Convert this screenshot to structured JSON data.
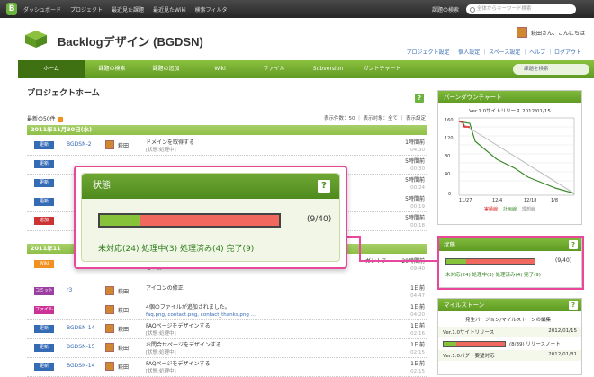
{
  "topbar": {
    "logo": "B",
    "nav": [
      "ダッシュボード",
      "プロジェクト",
      "最近見た課題",
      "最近見たWiki",
      "検索フィルタ"
    ],
    "settings": "課題の検索",
    "search_placeholder": "全体からキーワード検索"
  },
  "header": {
    "project_title": "Backlogデザイン (BGDSN)",
    "user_greeting": "萩田さん、こんにちは",
    "sublinks": "プロジェクト設定 ｜ 個人設定 ｜ スペース設定 ｜ ヘルプ ｜ ログアウト"
  },
  "navbar": {
    "items": [
      "ホーム",
      "課題の検索",
      "課題の追加",
      "Wiki",
      "ファイル",
      "Subversion",
      "ガントチャート"
    ],
    "search_placeholder": "課題を検索"
  },
  "main": {
    "title": "プロジェクトホーム",
    "latest_label": "最新の50件",
    "display_info": "表示件数：50 ｜ 表示対象：全て ｜ 表示設定",
    "day1": "2011年11月30日(水)",
    "day2": "2011年11",
    "rows": [
      {
        "badge": "更新",
        "color": "#356ab5",
        "key": "BGDSN-2",
        "user": "萩田",
        "text": "ドメインを取得する",
        "sub": "[状態:処理中]",
        "time": "1時間前",
        "time2": "04:30"
      },
      {
        "badge": "更新",
        "color": "#356ab5",
        "key": "",
        "user": "",
        "text": "",
        "sub": "",
        "time": "5時間前",
        "time2": "00:30"
      },
      {
        "badge": "更新",
        "color": "#356ab5",
        "key": "",
        "user": "",
        "text": "",
        "sub": "",
        "time": "5時間前",
        "time2": "00:24"
      },
      {
        "badge": "更新",
        "color": "#356ab5",
        "key": "",
        "user": "",
        "text": "",
        "sub": "",
        "time": "5時間前",
        "time2": "00:19"
      },
      {
        "badge": "追加",
        "color": "#cc3333",
        "key": "",
        "user": "",
        "text": "",
        "sub": "",
        "time": "5時間前",
        "time2": "00:18"
      }
    ],
    "rows2": [
      {
        "badge": "Wiki",
        "color": "#f29020",
        "key": "",
        "user": "",
        "text": "ーガントチ",
        "sub": "セー...",
        "time": "20時間前",
        "time2": "09:40"
      },
      {
        "badge": "コミット",
        "color": "#9b3fa0",
        "key": "r3",
        "user": "萩田",
        "text": "アイコンの修正",
        "sub": "",
        "time": "1日前",
        "time2": "04:47"
      },
      {
        "badge": "ファイル",
        "color": "#cc3399",
        "key": "",
        "user": "萩田",
        "text": "4個のファイルが追加されました。",
        "sub": "faq.png,  contact.png,  contact_thanks.png ...",
        "time": "1日前",
        "time2": "04:20"
      },
      {
        "badge": "更新",
        "color": "#356ab5",
        "key": "BGDSN-14",
        "user": "萩田",
        "text": "FAQページをデザインする",
        "sub": "[状態:処理中]",
        "time": "1日前",
        "time2": "02:16"
      },
      {
        "badge": "更新",
        "color": "#356ab5",
        "key": "BGDSN-15",
        "user": "萩田",
        "text": "お問合せページをデザインする",
        "sub": "[状態:処理中]",
        "time": "1日前",
        "time2": "02:15"
      },
      {
        "badge": "更新",
        "color": "#356ab5",
        "key": "BGDSN-14",
        "user": "萩田",
        "text": "FAQページをデザインする",
        "sub": "[状態:処理中]",
        "time": "1日前",
        "time2": "02:15"
      }
    ]
  },
  "burndown": {
    "title": "バーンダウンチャート",
    "caption": "Ver.1.0サイトリリース 2012/01/15",
    "legend": [
      "実績線",
      "計画線",
      "理想線"
    ]
  },
  "status_small": {
    "title": "状態",
    "count": "(9/40)",
    "legend": "未対応(24) 処理中(3) 処理済み(4) 完了(9)"
  },
  "milestone": {
    "title": "マイルストーン",
    "edit": "発生バージョン/マイルストーンの編集",
    "items": [
      {
        "name": "Ver.1.0サイトリリース",
        "date": "2012/01/15"
      },
      {
        "name": "",
        "date": "(8/39) リリースノート"
      },
      {
        "name": "Ver.1.0バグ・要望対応",
        "date": "2012/01/31"
      }
    ]
  },
  "popup": {
    "title": "状態",
    "help": "?",
    "count": "(9/40)",
    "legend": "未対応(24) 処理中(3) 処理済み(4) 完了(9)",
    "done_fraction": 0.225,
    "colors": {
      "done": "#86c23a",
      "open": "#f0685e",
      "accent": "#e8479a"
    }
  }
}
